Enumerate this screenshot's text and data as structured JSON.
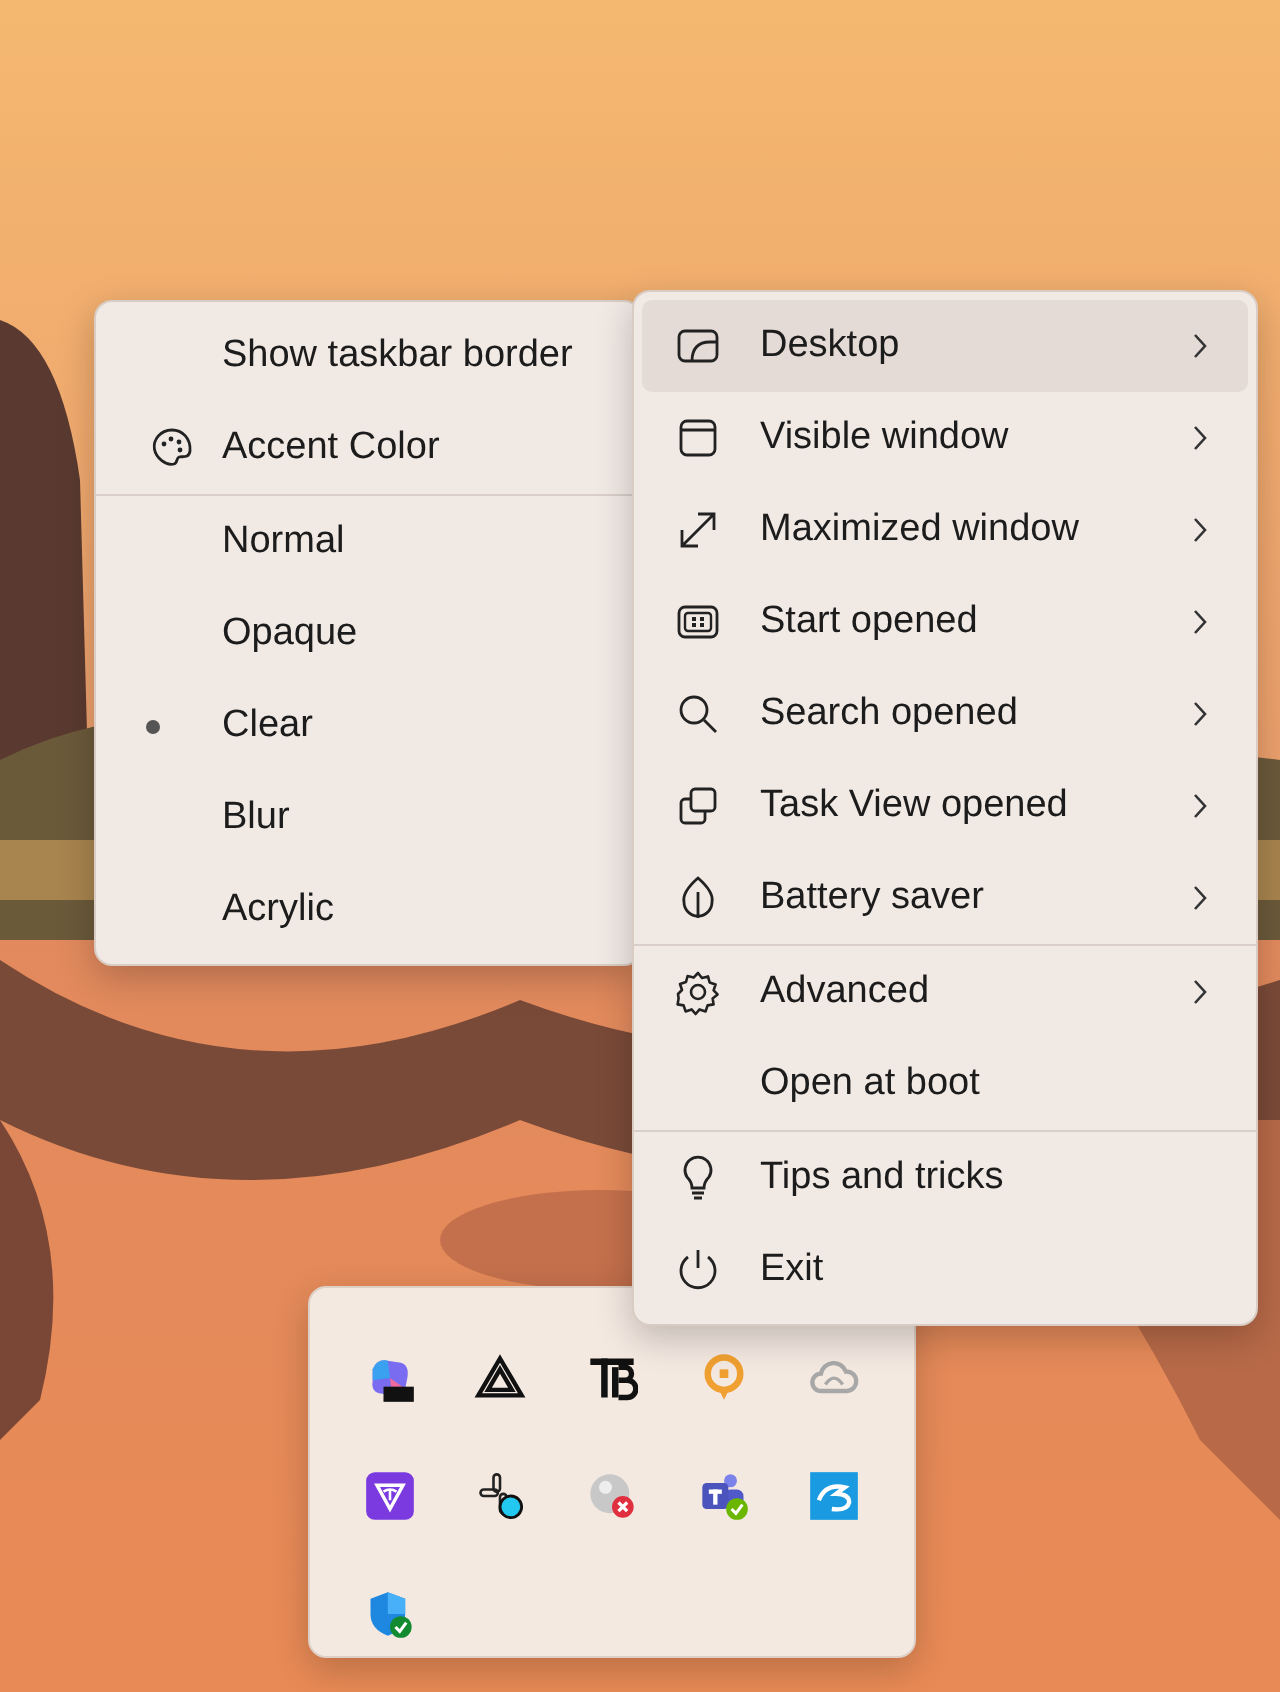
{
  "style_menu": {
    "groups": [
      [
        {
          "kind": "toggle",
          "label": "Show taskbar border",
          "checked": false
        },
        {
          "kind": "palette",
          "label": "Accent Color"
        }
      ],
      [
        {
          "kind": "radio",
          "label": "Normal",
          "selected": false
        },
        {
          "kind": "radio",
          "label": "Opaque",
          "selected": false
        },
        {
          "kind": "radio",
          "label": "Clear",
          "selected": true
        },
        {
          "kind": "radio",
          "label": "Blur",
          "selected": false
        },
        {
          "kind": "radio",
          "label": "Acrylic",
          "selected": false
        }
      ]
    ]
  },
  "main_menu": {
    "groups": [
      [
        {
          "kind": "desktop",
          "label": "Desktop",
          "submenu": true,
          "selected": true
        },
        {
          "kind": "window",
          "label": "Visible window",
          "submenu": true,
          "selected": false
        },
        {
          "kind": "maximize",
          "label": "Maximized window",
          "submenu": true,
          "selected": false
        },
        {
          "kind": "start",
          "label": "Start opened",
          "submenu": true,
          "selected": false
        },
        {
          "kind": "search",
          "label": "Search opened",
          "submenu": true,
          "selected": false
        },
        {
          "kind": "taskview",
          "label": "Task View opened",
          "submenu": true,
          "selected": false
        },
        {
          "kind": "leaf",
          "label": "Battery saver",
          "submenu": true,
          "selected": false
        }
      ],
      [
        {
          "kind": "gear",
          "label": "Advanced",
          "submenu": true,
          "selected": false
        },
        {
          "kind": "toggle",
          "label": "Open at boot",
          "submenu": false,
          "selected": false,
          "checked": false
        }
      ],
      [
        {
          "kind": "bulb",
          "label": "Tips and tricks",
          "submenu": false,
          "selected": false
        },
        {
          "kind": "power",
          "label": "Exit",
          "submenu": false,
          "selected": false
        }
      ]
    ]
  },
  "tray": {
    "icons": [
      {
        "kind": "gradient-tile"
      },
      {
        "kind": "penrose"
      },
      {
        "kind": "bars"
      },
      {
        "kind": "pin"
      },
      {
        "kind": "cloud"
      },
      {
        "kind": "purple-tile"
      },
      {
        "kind": "pinwheel"
      },
      {
        "kind": "globe-error"
      },
      {
        "kind": "people"
      },
      {
        "kind": "blue-tile"
      },
      {
        "kind": "shield"
      }
    ]
  }
}
